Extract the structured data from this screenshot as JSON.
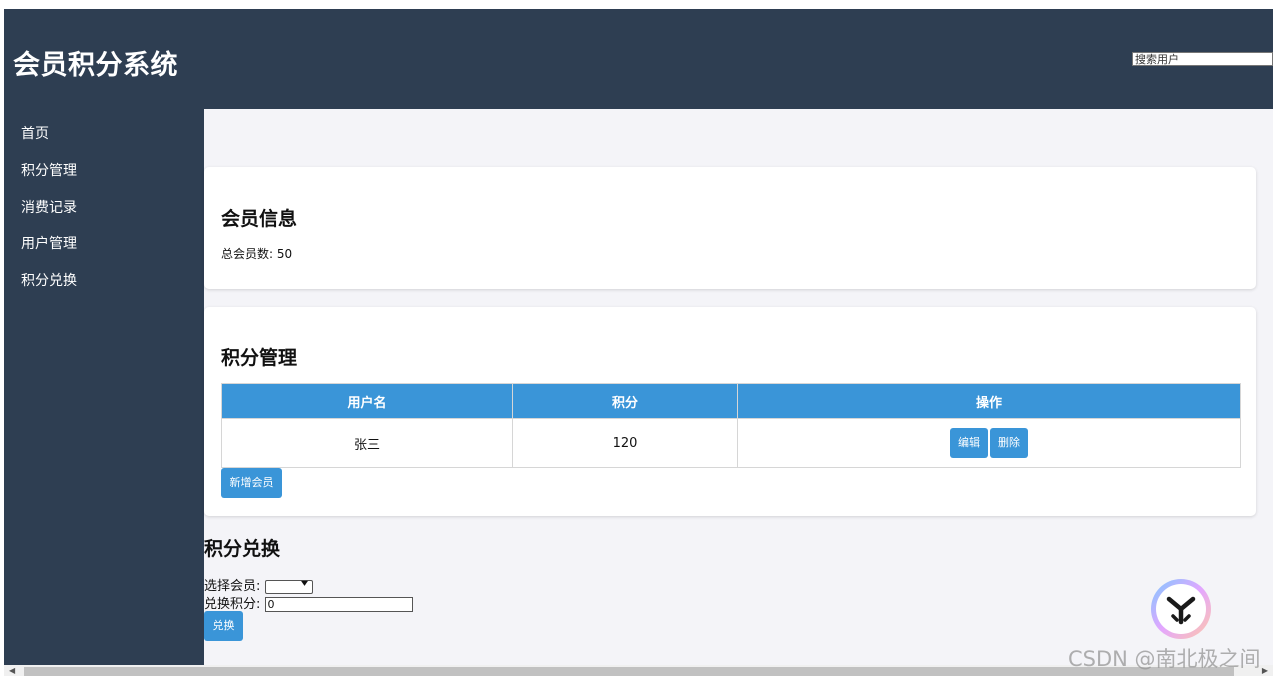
{
  "header": {
    "title": "会员积分系统",
    "search_placeholder": "搜索用户"
  },
  "sidebar": {
    "items": [
      {
        "label": "首页"
      },
      {
        "label": "积分管理"
      },
      {
        "label": "消费记录"
      },
      {
        "label": "用户管理"
      },
      {
        "label": "积分兑换"
      }
    ]
  },
  "member_info": {
    "title": "会员信息",
    "total_label": "总会员数: 50"
  },
  "points_management": {
    "title": "积分管理",
    "columns": [
      "用户名",
      "积分",
      "操作"
    ],
    "rows": [
      {
        "username": "张三",
        "points": "120",
        "edit_label": "编辑",
        "delete_label": "删除"
      }
    ],
    "add_button": "新增会员"
  },
  "exchange": {
    "title": "积分兑换",
    "select_label": "选择会员:",
    "points_label": "兑换积分:",
    "points_value": "0",
    "button": "兑换"
  },
  "watermark": "CSDN @南北极之间",
  "colors": {
    "header_bg": "#2e3e52",
    "accent": "#3a95d8",
    "page_bg": "#f4f4f8"
  },
  "icons": {
    "floating": "assistant-y-logo-icon",
    "dropdown": "chevron-down-icon"
  }
}
